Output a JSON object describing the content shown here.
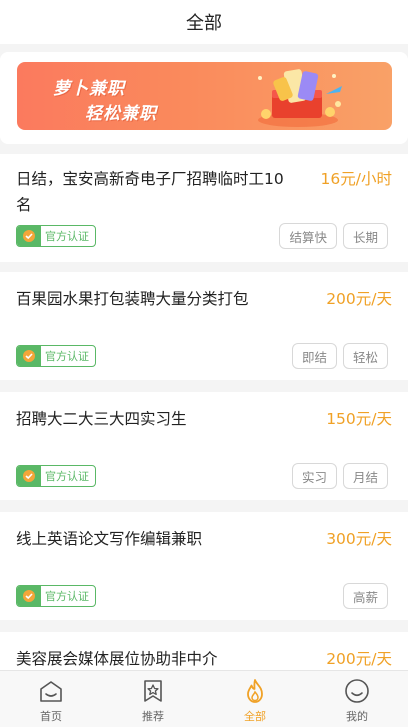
{
  "header": {
    "title": "全部"
  },
  "banner": {
    "line1": "萝卜兼职",
    "line2": "轻松兼职"
  },
  "badge_label": "官方认证",
  "jobs": [
    {
      "title_l1": "日结，宝安高新奇电子厂招聘临时工10",
      "title_l2": "名",
      "salary": "16元/小时",
      "tags": [
        "结算快",
        "长期"
      ]
    },
    {
      "title_l1": "百果园水果打包装聘大量分类打包",
      "title_l2": "",
      "salary": "200元/天",
      "tags": [
        "即结",
        "轻松"
      ]
    },
    {
      "title_l1": "招聘大二大三大四实习生",
      "title_l2": "",
      "salary": "150元/天",
      "tags": [
        "实习",
        "月结"
      ]
    },
    {
      "title_l1": "线上英语论文写作编辑兼职",
      "title_l2": "",
      "salary": "300元/天",
      "tags": [
        "高薪"
      ]
    },
    {
      "title_l1": "美容展会媒体展位协助非中介",
      "title_l2": "",
      "salary": "200元/天",
      "tags": []
    }
  ],
  "tabbar": {
    "items": [
      {
        "label": "首页",
        "icon": "home-icon",
        "active": false
      },
      {
        "label": "推荐",
        "icon": "star-icon",
        "active": false
      },
      {
        "label": "全部",
        "icon": "flame-icon",
        "active": true
      },
      {
        "label": "我的",
        "icon": "profile-icon",
        "active": false
      }
    ]
  },
  "colors": {
    "accent": "#f0a126",
    "verified": "#5ab866",
    "banner": "#fb7a5e"
  }
}
